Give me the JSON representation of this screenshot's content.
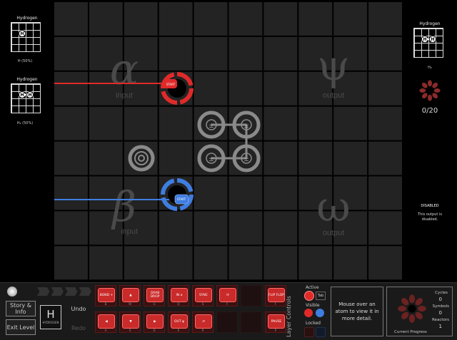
{
  "left_panel": {
    "molecules": [
      {
        "title": "Hydrogen",
        "caption": "H (50%)",
        "atoms": [
          "H"
        ]
      },
      {
        "title": "Hydrogen",
        "caption": "H₂ (50%)",
        "atoms": [
          "H",
          "H"
        ]
      }
    ]
  },
  "right_panel": {
    "target": {
      "title": "Hydrogen",
      "caption": "H₂",
      "atoms": [
        "H",
        "H"
      ]
    },
    "progress": "0/20",
    "disabled_title": "DISABLED",
    "disabled_text": "This output is disabled."
  },
  "reactor": {
    "regions": [
      {
        "symbol": "α",
        "label": "input"
      },
      {
        "symbol": "ψ",
        "label": "output"
      },
      {
        "symbol": "β",
        "label": "input"
      },
      {
        "symbol": "ω",
        "label": "output"
      }
    ],
    "start_red": "START",
    "start_blue": "START",
    "bond_symbol": "±",
    "colors": {
      "red": "#e02a2a",
      "blue": "#3f7de0",
      "bond": "#8a8a8a",
      "tile": "#232323"
    }
  },
  "bottom_bar": {
    "story_button": "Story & Info",
    "exit_button": "Exit Level",
    "element_symbol": "H",
    "element_name": "HYDROGEN",
    "undo_button": "Undo",
    "redo_button": "Redo",
    "tools_top": [
      {
        "label": "BOND +",
        "key": "B"
      },
      {
        "label": "▲",
        "key": "W"
      },
      {
        "label": "GRAB DROP",
        "key": "G"
      },
      {
        "label": "IN α",
        "key": "Q"
      },
      {
        "label": "SYNC",
        "key": "S"
      },
      {
        "label": "H",
        "key": "F"
      },
      {
        "label": "",
        "key": ""
      },
      {
        "label": "FLIP FLOP",
        "key": "F"
      }
    ],
    "tools_bottom": [
      {
        "label": "◀",
        "key": "A"
      },
      {
        "label": "▼",
        "key": "S"
      },
      {
        "label": "▶",
        "key": "D"
      },
      {
        "label": "OUT ψ",
        "key": "E"
      },
      {
        "label": "↺",
        "key": "R"
      },
      {
        "label": "",
        "key": ""
      },
      {
        "label": "",
        "key": ""
      },
      {
        "label": "PAUSE",
        "key": "P"
      }
    ],
    "layer_controls_label": "Layer Controls",
    "active_label": "Active",
    "tab_key": "Tab",
    "visible_label": "Visible",
    "locked_label": "Locked",
    "info_text": "Mouse over an atom to view it in more detail.",
    "stats": {
      "cycles_label": "Cycles",
      "cycles": "0",
      "symbols_label": "Symbols",
      "symbols": "0",
      "reactors_label": "Reactors",
      "reactors": "1"
    },
    "current_progress": "Current Progress"
  }
}
